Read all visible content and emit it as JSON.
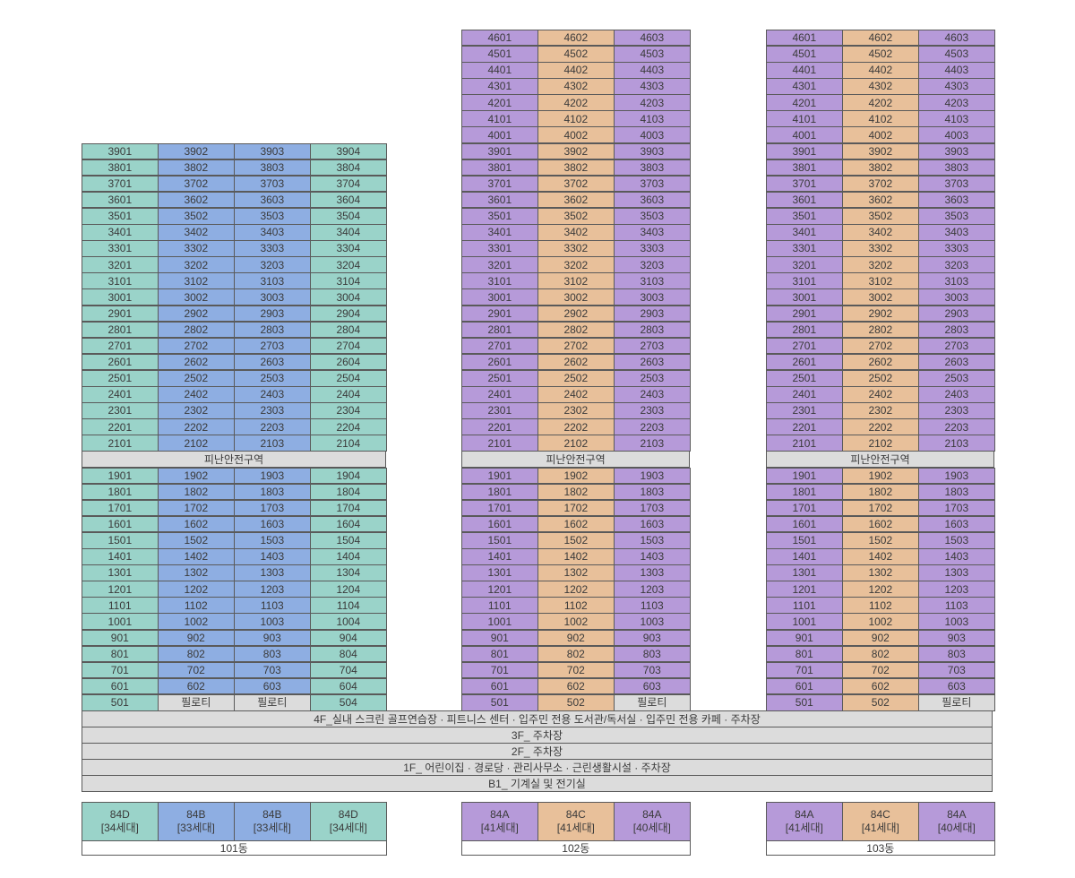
{
  "refuge_label": "피난안전구역",
  "piloti_label": "필로티",
  "shared_floors": [
    "4F_실내 스크린 골프연습장 · 피트니스 센터 · 입주민 전용 도서관/독서실 · 입주민 전용 카페 · 주차장",
    "3F_ 주차장",
    "2F_ 주차장",
    "1F_ 어린이집 · 경로당 · 관리사무소 · 근린생활시설 · 주차장",
    "B1_ 기계실 및 전기실"
  ],
  "buildings": [
    {
      "name": "101동",
      "top_floor": 39,
      "refuge_floor": 20,
      "columns": [
        {
          "unit": "01",
          "color": "teal",
          "type": "84D",
          "count": "[34세대]"
        },
        {
          "unit": "02",
          "color": "blue",
          "type": "84B",
          "count": "[33세대]"
        },
        {
          "unit": "03",
          "color": "blue",
          "type": "84B",
          "count": "[33세대]"
        },
        {
          "unit": "04",
          "color": "teal",
          "type": "84D",
          "count": "[34세대]"
        }
      ],
      "fifth_floor": [
        "501",
        "필로티",
        "필로티",
        "504"
      ]
    },
    {
      "name": "102동",
      "top_floor": 46,
      "refuge_floor": 20,
      "columns": [
        {
          "unit": "01",
          "color": "purple",
          "type": "84A",
          "count": "[41세대]"
        },
        {
          "unit": "02",
          "color": "tan",
          "type": "84C",
          "count": "[41세대]"
        },
        {
          "unit": "03",
          "color": "purple",
          "type": "84A",
          "count": "[40세대]"
        }
      ],
      "fifth_floor": [
        "501",
        "502",
        "필로티"
      ]
    },
    {
      "name": "103동",
      "top_floor": 46,
      "refuge_floor": 20,
      "columns": [
        {
          "unit": "01",
          "color": "purple",
          "type": "84A",
          "count": "[41세대]"
        },
        {
          "unit": "02",
          "color": "tan",
          "type": "84C",
          "count": "[41세대]"
        },
        {
          "unit": "03",
          "color": "purple",
          "type": "84A",
          "count": "[40세대]"
        }
      ],
      "fifth_floor": [
        "501",
        "502",
        "필로티"
      ]
    }
  ]
}
